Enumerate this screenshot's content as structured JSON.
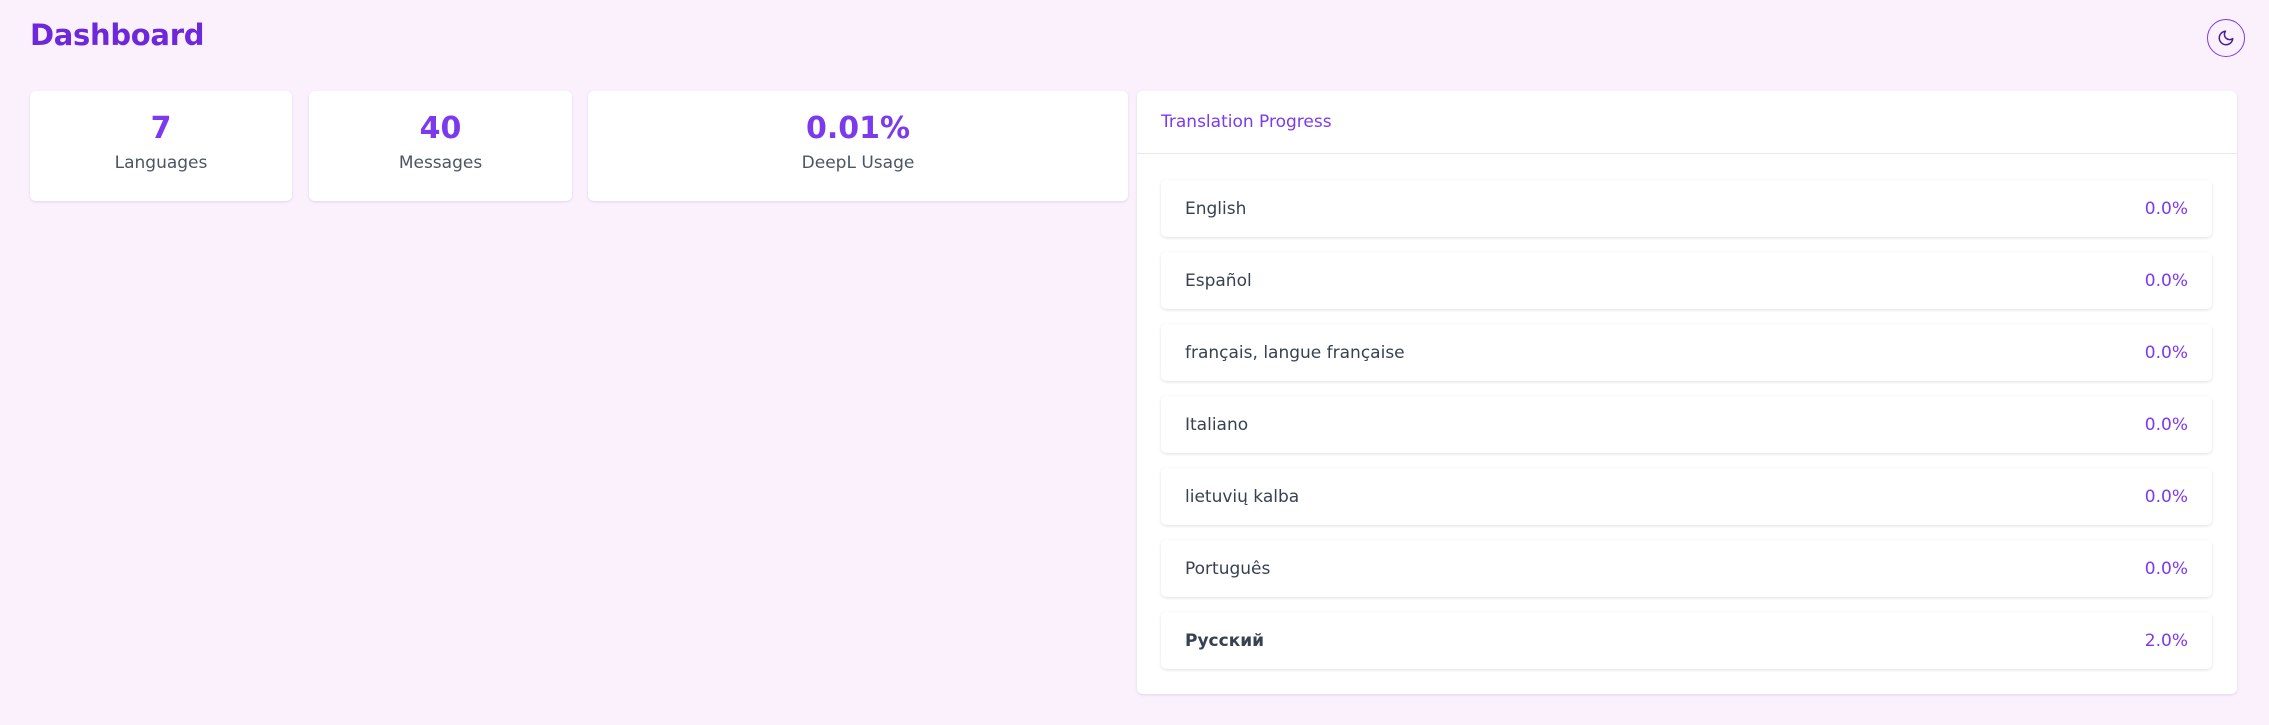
{
  "header": {
    "title": "Dashboard",
    "theme_toggle_icon": "moon-icon"
  },
  "stats": [
    {
      "value": "7",
      "label": "Languages"
    },
    {
      "value": "40",
      "label": "Messages"
    },
    {
      "value": "0.01%",
      "label": "DeepL Usage"
    }
  ],
  "progress": {
    "title": "Translation Progress",
    "languages": [
      {
        "name": "English",
        "percent": "0.0%"
      },
      {
        "name": "Español",
        "percent": "0.0%"
      },
      {
        "name": "français, langue française",
        "percent": "0.0%"
      },
      {
        "name": "Italiano",
        "percent": "0.0%"
      },
      {
        "name": "lietuvių kalba",
        "percent": "0.0%"
      },
      {
        "name": "Português",
        "percent": "0.0%"
      },
      {
        "name": "Русский",
        "percent": "2.0%",
        "current": true
      }
    ]
  },
  "colors": {
    "accent": "#7c3aed",
    "title": "#6d28d9",
    "background": "#faf1fd",
    "card": "#ffffff",
    "text": "#374151"
  }
}
